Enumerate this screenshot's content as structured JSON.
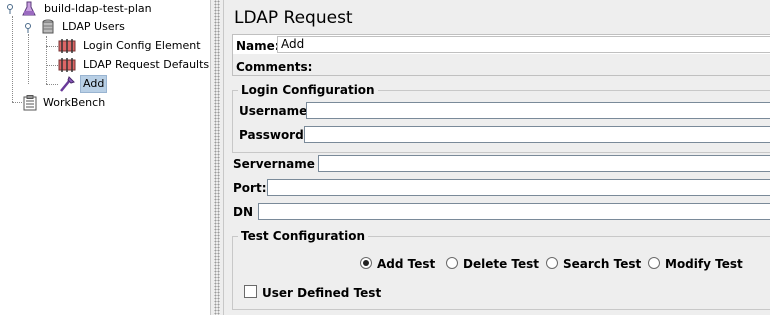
{
  "tree": {
    "items": [
      {
        "label": "build-ldap-test-plan",
        "icon": "flask-icon"
      },
      {
        "label": "LDAP Users",
        "icon": "thread-group-icon"
      },
      {
        "label": "Login Config Element",
        "icon": "config-element-icon"
      },
      {
        "label": "LDAP Request Defaults",
        "icon": "config-element-icon"
      },
      {
        "label": "Add",
        "icon": "sampler-icon",
        "selected": true
      },
      {
        "label": "WorkBench",
        "icon": "workbench-icon"
      }
    ]
  },
  "panel": {
    "title": "LDAP Request",
    "name_label": "Name:",
    "name_value": "Add",
    "comments_label": "Comments:",
    "login_group_title": "Login Configuration",
    "username_label": "Username",
    "username_value": "",
    "password_label": "Password",
    "password_value": "",
    "servername_label": "Servername :",
    "servername_value": "",
    "port_label": "Port:",
    "port_value": "",
    "dn_label": "DN",
    "dn_value": "",
    "test_group_title": "Test Configuration",
    "radios": [
      {
        "label": "Add Test",
        "selected": true
      },
      {
        "label": "Delete Test",
        "selected": false
      },
      {
        "label": "Search Test",
        "selected": false
      },
      {
        "label": "Modify Test",
        "selected": false
      }
    ],
    "user_defined_label": "User Defined Test",
    "user_defined_checked": false
  },
  "colors": {
    "selection": "#b8cfe5",
    "panel_bg": "#eeeeee"
  }
}
